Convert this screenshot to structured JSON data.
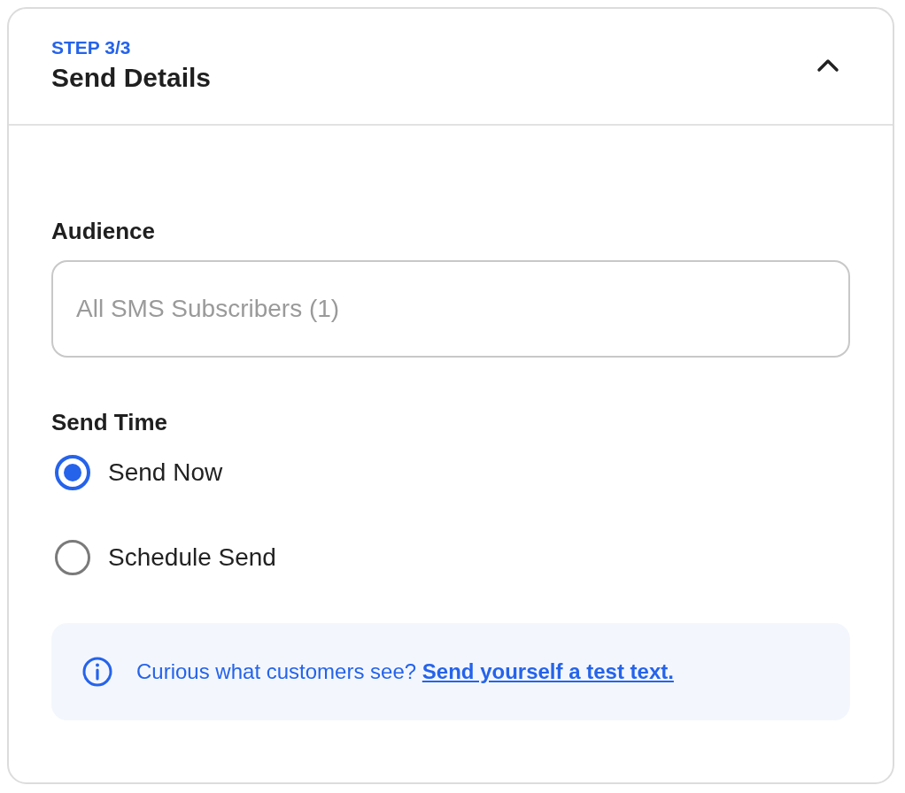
{
  "header": {
    "step": "STEP 3/3",
    "title": "Send Details",
    "expanded": true
  },
  "audience": {
    "label": "Audience",
    "placeholder": "All SMS Subscribers (1)"
  },
  "send_time": {
    "label": "Send Time",
    "options": [
      {
        "label": "Send Now",
        "selected": true
      },
      {
        "label": "Schedule Send",
        "selected": false
      }
    ]
  },
  "info": {
    "text": "Curious what customers see?",
    "link": "Send yourself a test text."
  }
}
